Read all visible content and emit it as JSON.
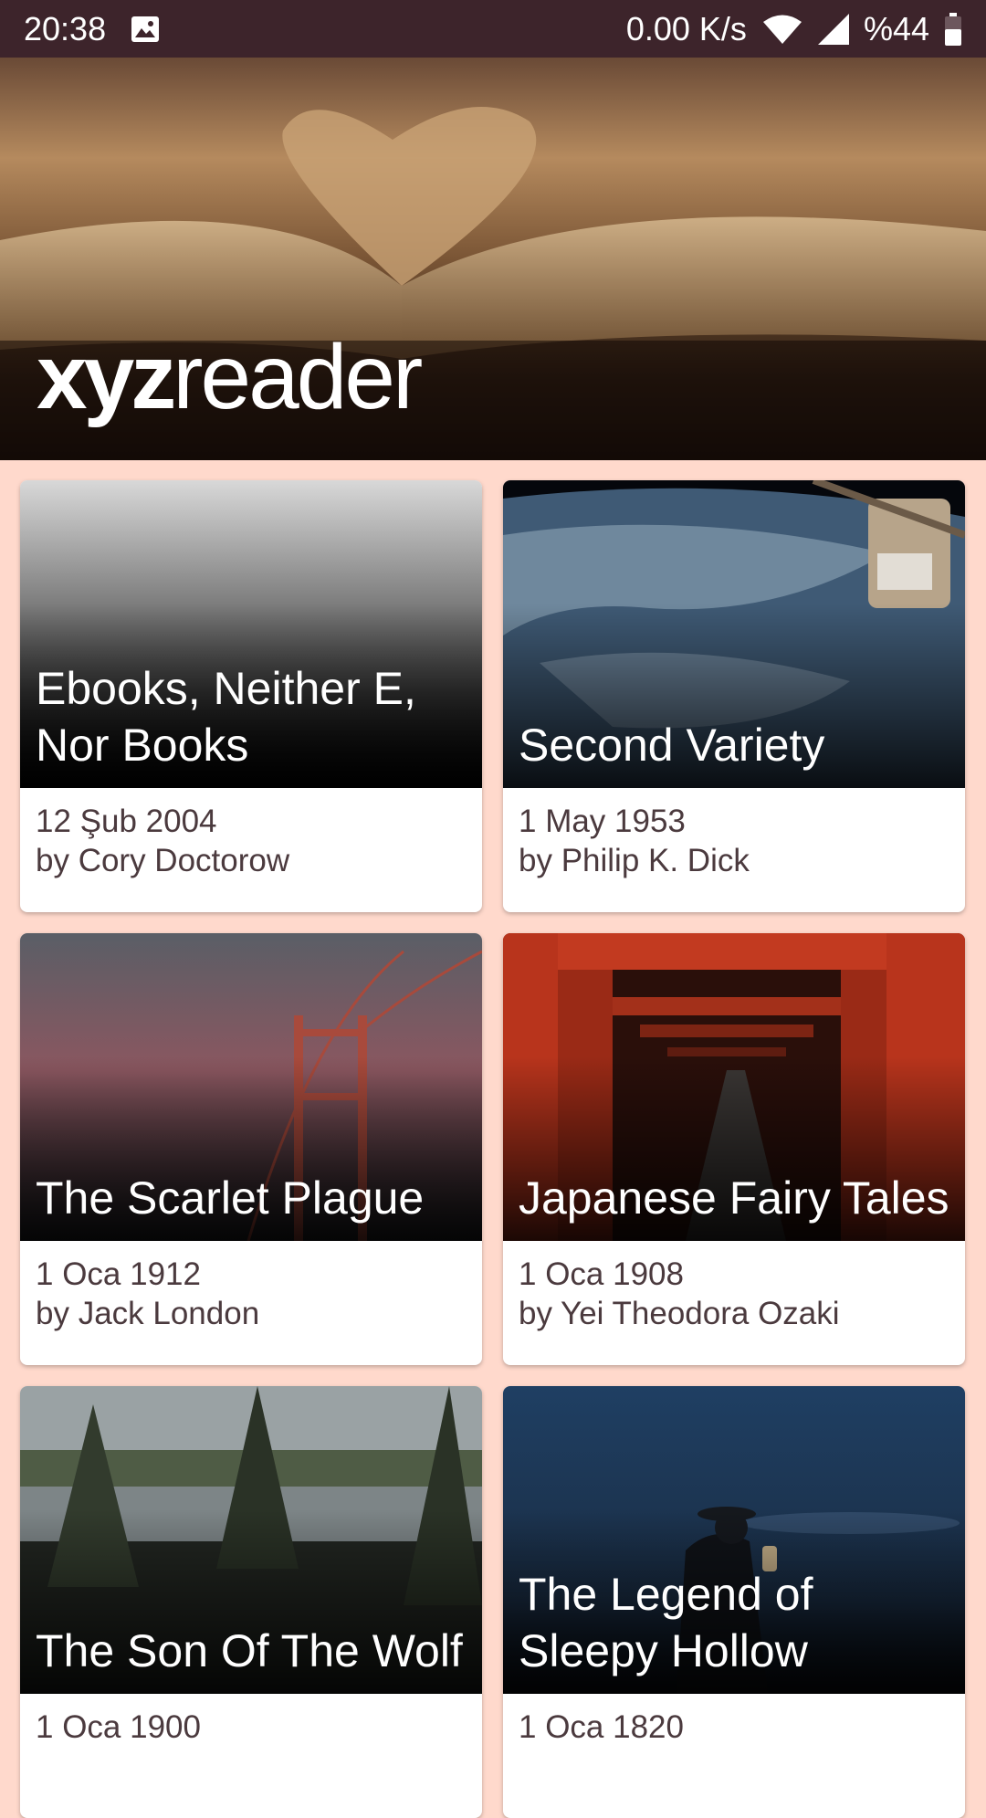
{
  "status_bar": {
    "time": "20:38",
    "speed": "0.00 K/s",
    "battery": "%44",
    "icons": [
      "image-icon",
      "wifi-icon",
      "signal-icon",
      "battery-icon"
    ]
  },
  "header": {
    "logo_bold": "xyz",
    "logo_light": "reader"
  },
  "articles": [
    {
      "title": "Ebooks, Neither E, Nor Books",
      "date": "12 Şub 2004",
      "author": "by Cory Doctorow"
    },
    {
      "title": "Second Variety",
      "date": "1 May 1953",
      "author": "by Philip K. Dick"
    },
    {
      "title": "The Scarlet Plague",
      "date": "1 Oca 1912",
      "author": "by Jack London"
    },
    {
      "title": "Japanese Fairy Tales",
      "date": "1 Oca 1908",
      "author": "by Yei Theodora Ozaki"
    },
    {
      "title": "The Son Of The Wolf",
      "date": "1 Oca 1900",
      "author": ""
    },
    {
      "title": "The Legend of Sleepy Hollow",
      "date": "1 Oca 1820",
      "author": ""
    }
  ],
  "colors": {
    "status_bar": "#3d242b",
    "background": "#ffd9cc",
    "meta_text": "#4b3a3e"
  }
}
